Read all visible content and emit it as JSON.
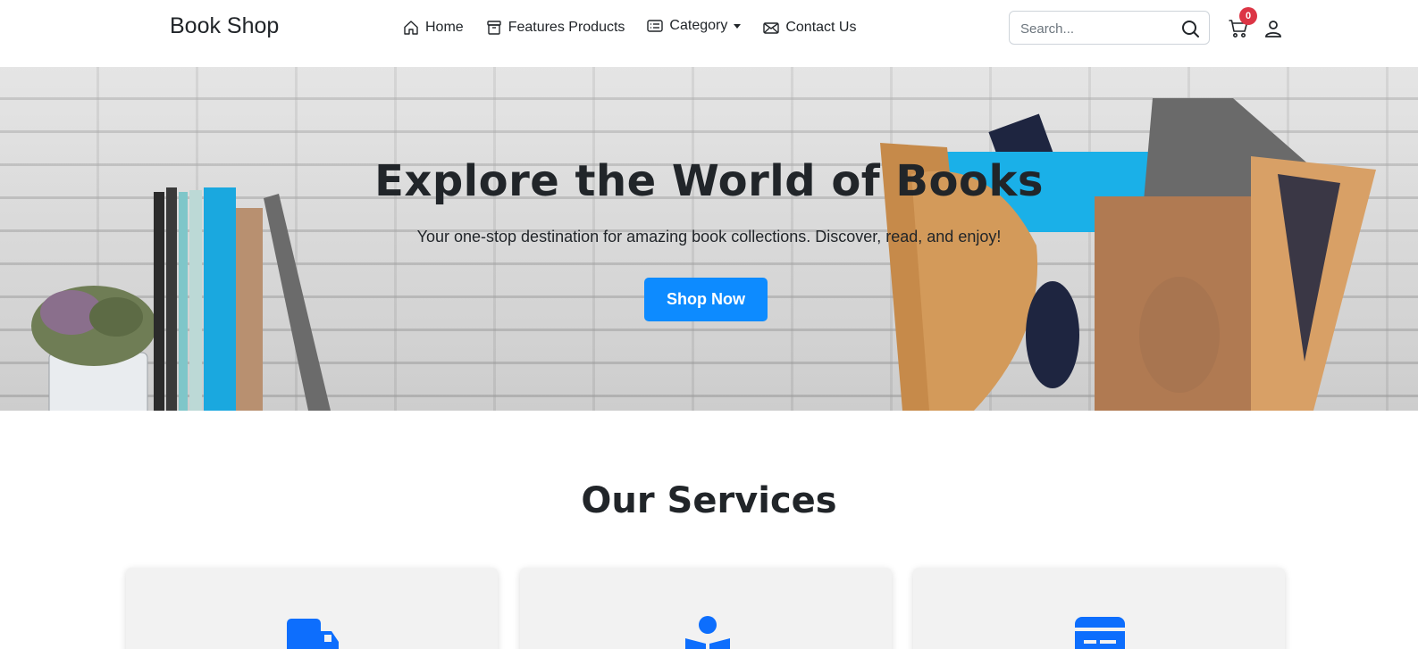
{
  "navbar": {
    "brand": "Book Shop",
    "links": [
      {
        "label": "Home",
        "icon": "house-icon"
      },
      {
        "label": "Features Products",
        "icon": "package-icon"
      },
      {
        "label": "Category",
        "icon": "card-list-icon"
      },
      {
        "label": "Contact Us",
        "icon": "envelope-icon"
      }
    ],
    "search": {
      "placeholder": "Search...",
      "value": ""
    },
    "cart_count": "0"
  },
  "hero": {
    "title": "Explore the World of Books",
    "subtitle": "Your one-stop destination for amazing book collections. Discover, read, and enjoy!",
    "cta": "Shop Now"
  },
  "services": {
    "title": "Our Services",
    "cards": [
      {
        "icon": "truck-icon"
      },
      {
        "icon": "book-reader-icon"
      },
      {
        "icon": "newspaper-icon"
      }
    ]
  },
  "colors": {
    "primary": "#0d8bff",
    "badge": "#dc3545",
    "icon_blue": "#0d6efd",
    "text": "#212529"
  }
}
